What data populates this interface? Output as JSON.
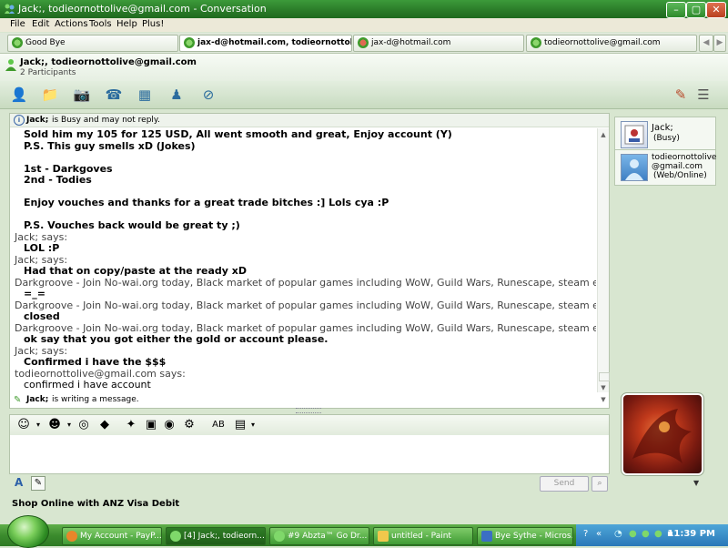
{
  "window": {
    "title": "Jack;, todieornottolive@gmail.com - Conversation"
  },
  "menu": {
    "items": [
      {
        "label": "File"
      },
      {
        "label": "Edit"
      },
      {
        "label": "Actions"
      },
      {
        "label": "Tools"
      },
      {
        "label": "Help"
      },
      {
        "label": "Plus!"
      }
    ]
  },
  "tabs": [
    {
      "label": "Good Bye",
      "active": false
    },
    {
      "label": "jax-d@hotmail.com, todieornottoli...",
      "active": true
    },
    {
      "label": "jax-d@hotmail.com",
      "active": false
    },
    {
      "label": "todieornottolive@gmail.com",
      "active": false
    }
  ],
  "conversation": {
    "participants_title": "Jack;, todieornottolive@gmail.com",
    "participants_count": "2 Participants",
    "status_name": "Jack;",
    "status_text": "is Busy and may not reply.",
    "typing_name": "Jack;",
    "typing_text": "is writing a message."
  },
  "chat": [
    {
      "kind": "msg",
      "text": "Sold him my 105 for 125 USD, All went smooth and great, Enjoy account (Y)"
    },
    {
      "kind": "msg",
      "text": "P.S. This guy smells xD (Jokes)"
    },
    {
      "kind": "msg",
      "text": ""
    },
    {
      "kind": "msg",
      "text": "1st - Darkgoves"
    },
    {
      "kind": "msg",
      "text": "2nd - Todies"
    },
    {
      "kind": "msg",
      "text": ""
    },
    {
      "kind": "msg",
      "text": "Enjoy vouches and thanks for a great trade bitches :] Lols cya :P"
    },
    {
      "kind": "msg",
      "text": ""
    },
    {
      "kind": "msg",
      "text": "P.S. Vouches back would be great ty ;)"
    },
    {
      "kind": "says",
      "text": "Jack; says:"
    },
    {
      "kind": "msg",
      "text": "LOL :P"
    },
    {
      "kind": "says",
      "text": "Jack; says:"
    },
    {
      "kind": "msg",
      "text": "Had that on copy/paste at the ready xD"
    },
    {
      "kind": "says",
      "text": "Darkgroove - Join No-wai.org today, Black market of popular games including WoW, Guild Wars, Runescape, steam etc says:"
    },
    {
      "kind": "msg",
      "text": "=_="
    },
    {
      "kind": "says",
      "text": "Darkgroove - Join No-wai.org today, Black market of popular games including WoW, Guild Wars, Runescape, steam etc says:"
    },
    {
      "kind": "msg",
      "text": "closed"
    },
    {
      "kind": "says",
      "text": "Darkgroove - Join No-wai.org today, Black market of popular games including WoW, Guild Wars, Runescape, steam etc says:"
    },
    {
      "kind": "msg",
      "text": "ok say that you got either the gold or account please."
    },
    {
      "kind": "says",
      "text": "Jack; says:"
    },
    {
      "kind": "msg",
      "text": "Confirmed i have the $$$"
    },
    {
      "kind": "says",
      "text": "todieornottolive@gmail.com says:"
    },
    {
      "kind": "msgn",
      "text": "confirmed i have account"
    }
  ],
  "input": {
    "send_label": "Send"
  },
  "ad": {
    "text": "Shop Online with ANZ Visa Debit"
  },
  "contacts": [
    {
      "name": "Jack;",
      "status": "(Busy)"
    },
    {
      "name_line1": "todieornottolive",
      "name_line2": "@gmail.com",
      "status": "(Web/Online)"
    }
  ],
  "taskbar": {
    "tasks": [
      {
        "label": "My Account - PayP...",
        "active": false
      },
      {
        "label": "[4] Jack;, todieorn...",
        "active": true
      },
      {
        "label": "#9 Abzta™ Go Dr...",
        "active": false
      },
      {
        "label": "untitled - Paint",
        "active": false
      },
      {
        "label": "Bye Sythe - Micros...",
        "active": false
      }
    ],
    "clock": "11:39 PM"
  },
  "colors": {
    "title_green": "#2a7a28",
    "taskbar_green": "#3b8b2d",
    "tray_blue": "#2a78b8"
  }
}
